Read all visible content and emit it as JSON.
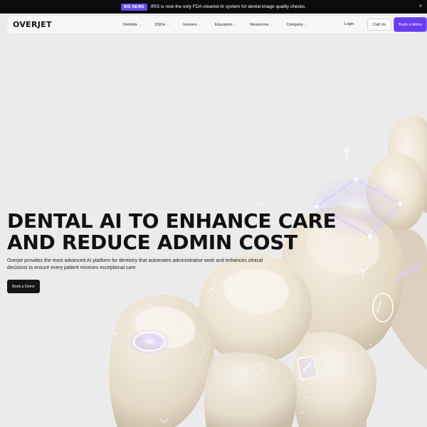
{
  "announcement": {
    "badge": "BIG NEWS",
    "message": "IRIS is now the only FDA-cleared AI system for dental image quality checks.",
    "close_icon": "close-icon"
  },
  "nav": {
    "logo": "OVERJET",
    "menu": [
      {
        "label": "Dentists",
        "icon": "chevron-down-icon"
      },
      {
        "label": "DSOs",
        "icon": "chevron-down-icon"
      },
      {
        "label": "Insurers",
        "icon": "chevron-down-icon"
      },
      {
        "label": "Educators",
        "icon": "chevron-down-icon"
      },
      {
        "label": "Resources",
        "icon": "chevron-down-icon"
      },
      {
        "label": "Company",
        "icon": "chevron-down-icon"
      }
    ],
    "login": "Login",
    "call_us": "Call Us",
    "book_demo": "Book a demo"
  },
  "hero": {
    "title_line1": "DENTAL AI TO ENHANCE CARE",
    "title_line2": "AND REDUCE ADMIN COST",
    "subtitle": "Overjet provides the most advanced AI platform for dentistry that automates administrative work and enhances clinical decisions to ensure every patient receives exceptional care.",
    "cta": "Book a Demo"
  },
  "colors": {
    "accent": "#6a3df0",
    "announce_bg": "#0b0b0d",
    "hero_bg": "#ecebec",
    "glow": "#b9a8ff"
  }
}
